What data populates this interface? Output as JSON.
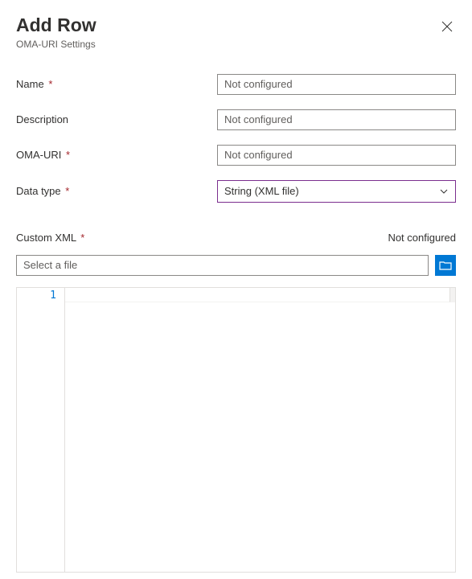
{
  "header": {
    "title": "Add Row",
    "subtitle": "OMA-URI Settings"
  },
  "fields": {
    "name": {
      "label": "Name",
      "placeholder": "Not configured"
    },
    "description": {
      "label": "Description",
      "placeholder": "Not configured"
    },
    "oma_uri": {
      "label": "OMA-URI",
      "placeholder": "Not configured"
    },
    "data_type": {
      "label": "Data type",
      "value": "String (XML file)"
    }
  },
  "custom_xml": {
    "label": "Custom XML",
    "status": "Not configured",
    "file_placeholder": "Select a file",
    "line_number": "1"
  },
  "required_marker": "*"
}
